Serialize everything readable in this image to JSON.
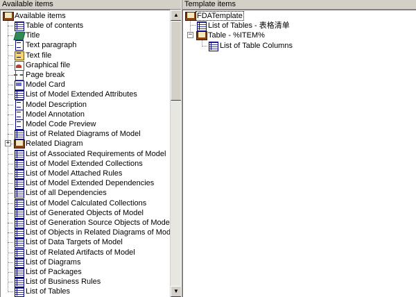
{
  "left_pane": {
    "header": "Available items",
    "root": {
      "label": "Available items",
      "icon": "book-icon"
    },
    "items": [
      {
        "label": "Table of contents",
        "icon": "toc-icon"
      },
      {
        "label": "Title",
        "icon": "title-icon"
      },
      {
        "label": "Text paragraph",
        "icon": "document-icon"
      },
      {
        "label": "Text file",
        "icon": "text-file-icon"
      },
      {
        "label": "Graphical file",
        "icon": "graphic-file-icon"
      },
      {
        "label": "Page break",
        "icon": "page-break-icon"
      },
      {
        "label": "Model Card",
        "icon": "card-icon"
      },
      {
        "label": "List of Model Extended Attributes",
        "icon": "list-icon"
      },
      {
        "label": "Model Description",
        "icon": "document-icon"
      },
      {
        "label": "Model Annotation",
        "icon": "document-icon"
      },
      {
        "label": "Model Code Preview",
        "icon": "document-icon"
      },
      {
        "label": "List of Related Diagrams of Model",
        "icon": "list-icon"
      },
      {
        "label": "Related Diagram",
        "icon": "book-icon",
        "expander": "+"
      },
      {
        "label": "List of Associated Requirements of Model",
        "icon": "list-icon"
      },
      {
        "label": "List of Model Extended Collections",
        "icon": "list-icon"
      },
      {
        "label": "List of Model Attached Rules",
        "icon": "list-icon"
      },
      {
        "label": "List of Model Extended Dependencies",
        "icon": "list-icon"
      },
      {
        "label": "List of all Dependencies",
        "icon": "list-icon"
      },
      {
        "label": "List of Model Calculated Collections",
        "icon": "list-icon"
      },
      {
        "label": "List of Generated Objects of Model",
        "icon": "list-icon"
      },
      {
        "label": "List of Generation Source Objects of Model",
        "icon": "list-icon"
      },
      {
        "label": "List of Objects in Related Diagrams of Model",
        "icon": "list-icon"
      },
      {
        "label": "List of Data Targets of Model",
        "icon": "list-icon"
      },
      {
        "label": "List of Related Artifacts of Model",
        "icon": "list-icon"
      },
      {
        "label": "List of Diagrams",
        "icon": "list-icon"
      },
      {
        "label": "List of Packages",
        "icon": "list-icon"
      },
      {
        "label": "List of Business Rules",
        "icon": "list-icon"
      },
      {
        "label": "List of Tables",
        "icon": "list-icon"
      }
    ]
  },
  "right_pane": {
    "header": "Template items",
    "root": {
      "label": "FDATemplate",
      "icon": "book-icon"
    },
    "items": [
      {
        "label": "List of Tables - 表格清单",
        "icon": "list-icon"
      },
      {
        "label": "Table - %ITEM%",
        "icon": "book-icon",
        "expander": "−"
      },
      {
        "label": "List of Table Columns",
        "icon": "list-icon"
      }
    ]
  },
  "scrollbar": {
    "up_arrow": "▲",
    "down_arrow": "▼"
  }
}
